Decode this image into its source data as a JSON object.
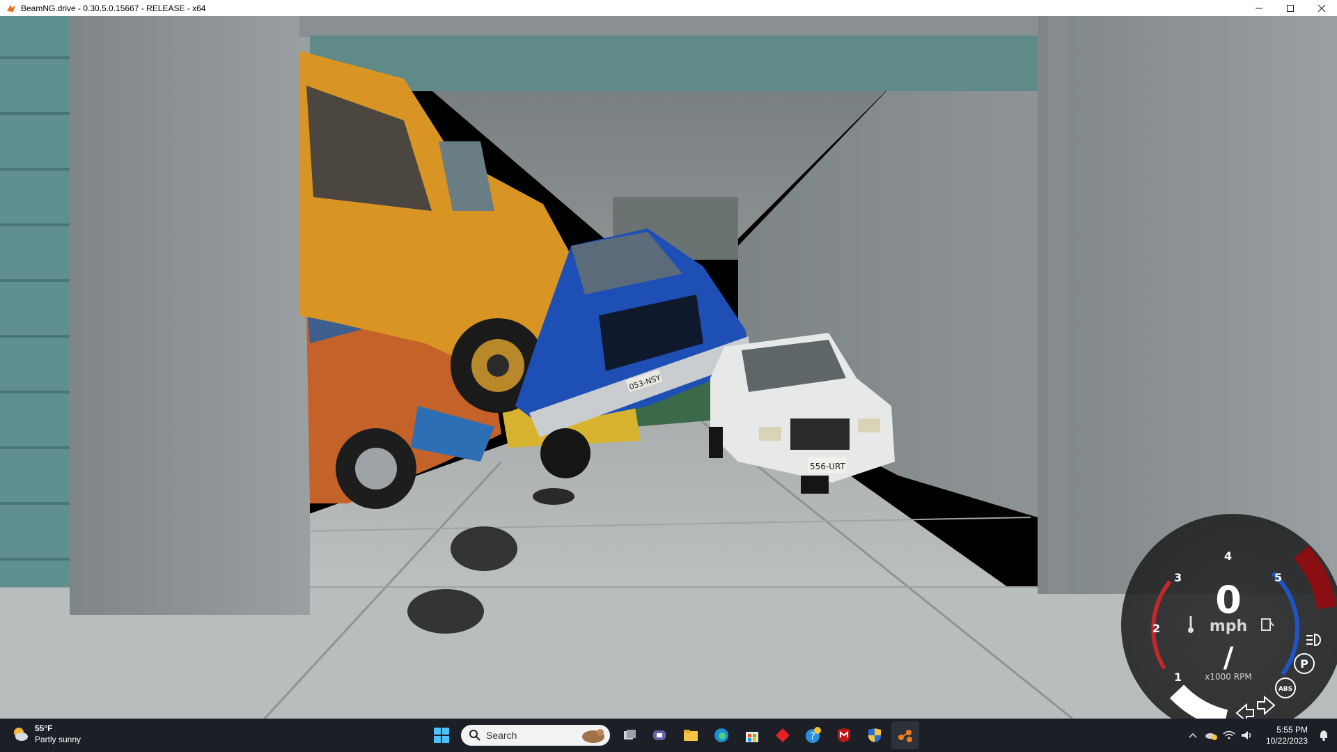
{
  "window": {
    "title": "BeamNG.drive - 0.30.5.0.15667 - RELEASE - x64",
    "controls": [
      "minimize-icon",
      "maximize-icon",
      "close-icon"
    ]
  },
  "scene": {
    "plate_blue_truck": "053-NSY",
    "plate_white_van": "556-URT"
  },
  "hud": {
    "speed": "0",
    "speed_unit": "mph",
    "rpm_unit": "x1000 RPM",
    "rpm_ticks": [
      "1",
      "2",
      "3",
      "4",
      "5"
    ],
    "gear": "/",
    "parking_label": "P",
    "abs_label": "ABS",
    "colors": {
      "cold": "#c0282c",
      "fuel": "#1e56c8",
      "redline": "#8b0f12"
    }
  },
  "taskbar": {
    "weather": {
      "temp": "55°F",
      "condition": "Partly sunny"
    },
    "search_placeholder": "Search",
    "pinned_icons": [
      "windows-start-icon",
      "task-view-icon",
      "teams-chat-icon",
      "file-explorer-icon",
      "edge-icon",
      "store-icon",
      "app-red-diamond-icon",
      "help-icon",
      "mcafee-icon",
      "security-shield-icon",
      "beamng-icon"
    ],
    "clock": {
      "time": "5:55 PM",
      "date": "10/22/2023"
    }
  }
}
